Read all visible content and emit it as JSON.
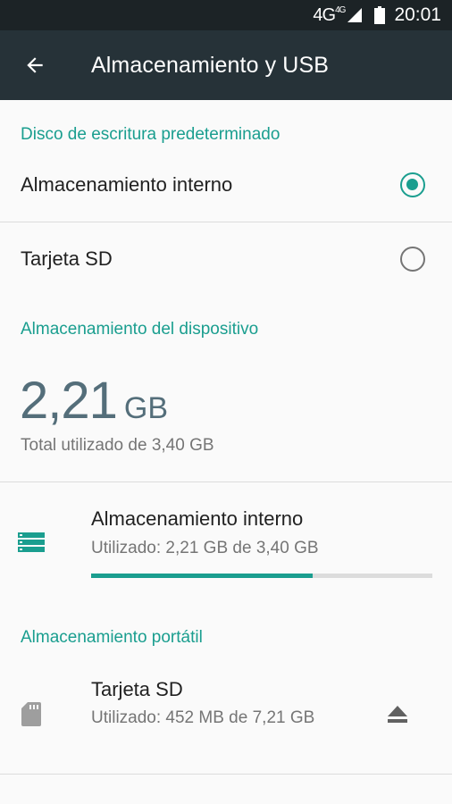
{
  "status_bar": {
    "network": "4G",
    "network_sup": "4G",
    "time": "20:01",
    "icons": [
      "signal-icon",
      "battery-icon"
    ]
  },
  "app_bar": {
    "title": "Almacenamiento y USB",
    "back_icon": "arrow-back-icon"
  },
  "default_write_disk": {
    "header": "Disco de escritura predeterminado",
    "options": [
      {
        "label": "Almacenamiento interno",
        "selected": true
      },
      {
        "label": "Tarjeta SD",
        "selected": false
      }
    ]
  },
  "device_storage": {
    "header": "Almacenamiento del dispositivo",
    "used_value": "2,21",
    "used_unit": "GB",
    "total_text": "Total utilizado de 3,40 GB",
    "internal": {
      "icon": "storage-icon",
      "title": "Almacenamiento interno",
      "subtitle": "Utilizado: 2,21 GB de 3,40 GB",
      "used_fraction": 0.65
    }
  },
  "portable_storage": {
    "header": "Almacenamiento portátil",
    "sd": {
      "icon": "sd-card-icon",
      "title": "Tarjeta SD",
      "subtitle": "Utilizado: 452 MB de 7,21 GB",
      "action_icon": "eject-icon"
    }
  },
  "colors": {
    "accent": "#1a9e8f",
    "app_bar": "#263238",
    "status_bar": "#1c2326",
    "big_number": "#546e7a"
  }
}
